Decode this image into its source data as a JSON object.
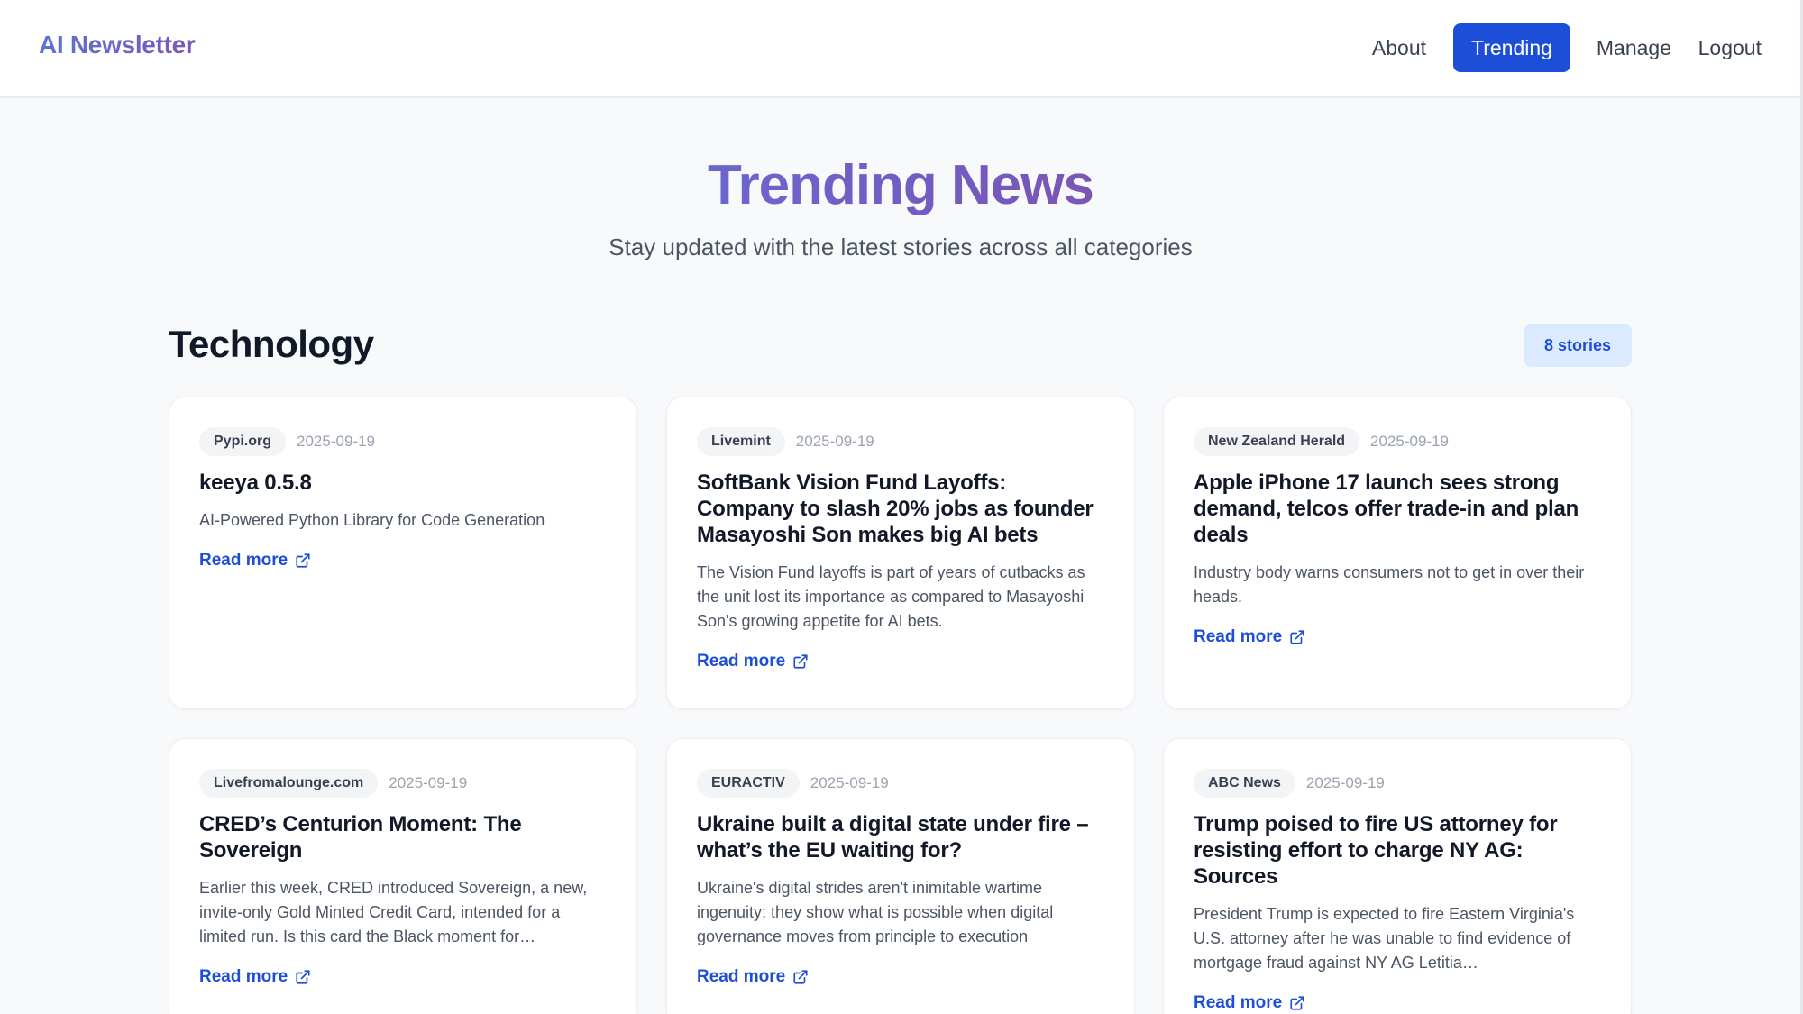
{
  "brand": "AI Newsletter",
  "nav": {
    "about": "About",
    "trending": "Trending",
    "manage": "Manage",
    "logout": "Logout"
  },
  "hero": {
    "title": "Trending News",
    "subtitle": "Stay updated with the latest stories across all categories"
  },
  "section": {
    "title": "Technology",
    "count": "8 stories"
  },
  "read_more_label": "Read more",
  "icons": {
    "read_more": "external-link-icon"
  },
  "colors": {
    "accent": "#1d4ed8",
    "brand_gradient_start": "#5b74d8",
    "brand_gradient_end": "#7c55b8",
    "badge_bg": "#dbeafe"
  },
  "articles": [
    {
      "source": "Pypi.org",
      "date": "2025-09-19",
      "title": "keeya 0.5.8",
      "description": "AI-Powered Python Library for Code Generation"
    },
    {
      "source": "Livemint",
      "date": "2025-09-19",
      "title": "SoftBank Vision Fund Layoffs: Company to slash 20% jobs as founder Masayoshi Son makes big AI bets",
      "description": "The Vision Fund layoffs is part of years of cutbacks as the unit lost its importance as compared to Masayoshi Son's growing appetite for AI bets."
    },
    {
      "source": "New Zealand Herald",
      "date": "2025-09-19",
      "title": "Apple iPhone 17 launch sees strong demand, telcos offer trade-in and plan deals",
      "description": "Industry body warns consumers not to get in over their heads."
    },
    {
      "source": "Livefromalounge.com",
      "date": "2025-09-19",
      "title": "CRED’s Centurion Moment: The Sovereign",
      "description": "Earlier this week, CRED introduced Sovereign, a new, invite-only Gold Minted Credit Card, intended for a limited run. Is this card the Black moment for…"
    },
    {
      "source": "EURACTIV",
      "date": "2025-09-19",
      "title": "Ukraine built a digital state under fire – what’s the EU waiting for?",
      "description": "Ukraine's digital strides aren't inimitable wartime ingenuity; they show what is possible when digital governance moves from principle to execution"
    },
    {
      "source": "ABC News",
      "date": "2025-09-19",
      "title": "Trump poised to fire US attorney for resisting effort to charge NY AG: Sources",
      "description": "President Trump is expected to fire Eastern Virginia's U.S. attorney after he was unable to find evidence of mortgage fraud against NY AG Letitia…"
    }
  ]
}
